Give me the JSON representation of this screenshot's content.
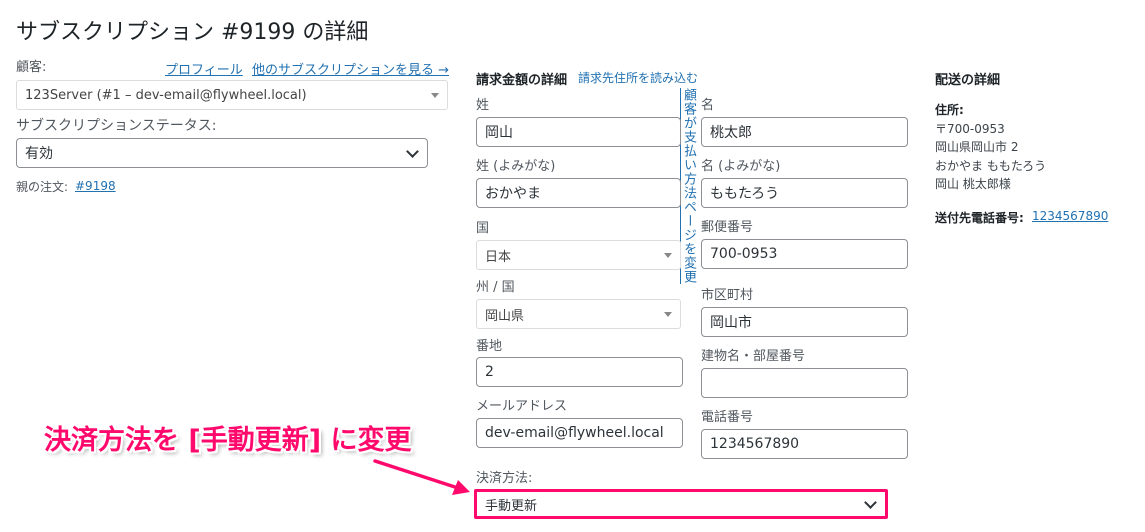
{
  "page": {
    "title": "サブスクリプション #9199 の詳細"
  },
  "general": {
    "customer_label": "顧客:",
    "profile_link": "プロフィール",
    "other_subscriptions_link": "他のサブスクリプションを見る →",
    "customer_value": "123Server (#1 – dev-email@flywheel.local)",
    "status_label": "サブスクリプションステータス:",
    "status_value": "有効",
    "parent_order_label": "親の注文:",
    "parent_order_link": "#9198"
  },
  "billing": {
    "heading": "請求金額の詳細",
    "load_address_link": "請求先住所を読み込む",
    "change_payment_link": "顧客が支払い方法ページを変更",
    "last_name_label": "姓",
    "last_name_value": "岡山",
    "first_name_label": "名",
    "first_name_value": "桃太郎",
    "last_name_kana_label": "姓 (よみがな)",
    "last_name_kana_value": "おかやま",
    "first_name_kana_label": "名 (よみがな)",
    "first_name_kana_value": "ももたろう",
    "country_label": "国",
    "country_value": "日本",
    "postcode_label": "郵便番号",
    "postcode_value": "700-0953",
    "state_label": "州 / 国",
    "state_value": "岡山県",
    "city_label": "市区町村",
    "city_value": "岡山市",
    "address1_label": "番地",
    "address1_value": "2",
    "address2_label": "建物名・部屋番号",
    "address2_value": "",
    "email_label": "メールアドレス",
    "email_value": "dev-email@flywheel.local",
    "phone_label": "電話番号",
    "phone_value": "1234567890",
    "payment_method_label": "決済方法:",
    "payment_method_value": "手動更新"
  },
  "shipping": {
    "heading": "配送の詳細",
    "address_label": "住所:",
    "address_lines": [
      "〒700-0953",
      "岡山県岡山市 2",
      "おかやま ももたろう",
      "岡山 桃太郎様"
    ],
    "phone_label": "送付先電話番号:",
    "phone_link": "1234567890"
  },
  "annotation": {
    "text": "決済方法を [手動更新] に変更",
    "color": "#ff0a6c"
  }
}
